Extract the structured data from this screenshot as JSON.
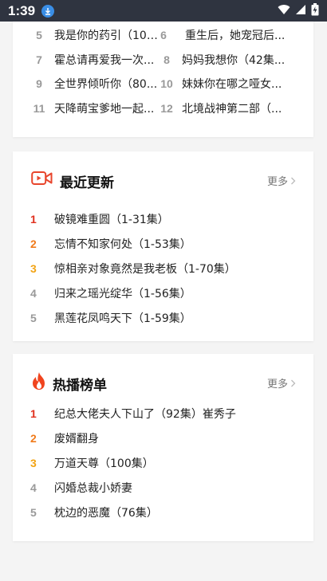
{
  "status_bar": {
    "time": "1:39"
  },
  "recommend": {
    "items": [
      {
        "num": "5",
        "title": "我是你的药引（100..."
      },
      {
        "num": "6",
        "title": "重生后，她宠冠后..."
      },
      {
        "num": "7",
        "title": "霍总请再爱我一次..."
      },
      {
        "num": "8",
        "title": "妈妈我想你（42集..."
      },
      {
        "num": "9",
        "title": "全世界倾听你（80..."
      },
      {
        "num": "10",
        "title": "妹妹你在哪之哑女..."
      },
      {
        "num": "11",
        "title": "天降萌宝爹地一起..."
      },
      {
        "num": "12",
        "title": "北境战神第二部（..."
      }
    ]
  },
  "latest": {
    "title": "最近更新",
    "more_label": "更多",
    "items": [
      {
        "num": "1",
        "title": "破镜难重圆（1-31集）"
      },
      {
        "num": "2",
        "title": "忘情不知家何处（1-53集）"
      },
      {
        "num": "3",
        "title": "惊相亲对象竟然是我老板（1-70集）"
      },
      {
        "num": "4",
        "title": "归来之瑶光绽华（1-56集）"
      },
      {
        "num": "5",
        "title": "黑莲花凤鸣天下（1-59集）"
      }
    ]
  },
  "hot": {
    "title": "热播榜单",
    "more_label": "更多",
    "items": [
      {
        "num": "1",
        "title": "纪总大佬夫人下山了（92集）崔秀子"
      },
      {
        "num": "2",
        "title": "废婿翻身"
      },
      {
        "num": "3",
        "title": "万道天尊（100集）"
      },
      {
        "num": "4",
        "title": "闪婚总裁小娇妻"
      },
      {
        "num": "5",
        "title": "枕边的恶魔（76集）"
      }
    ]
  },
  "colors": {
    "rank1": "#e0301e",
    "rank2": "#f07a1a",
    "rank3": "#f2a313",
    "rank_other": "#999999",
    "accent": "#e8452c"
  }
}
